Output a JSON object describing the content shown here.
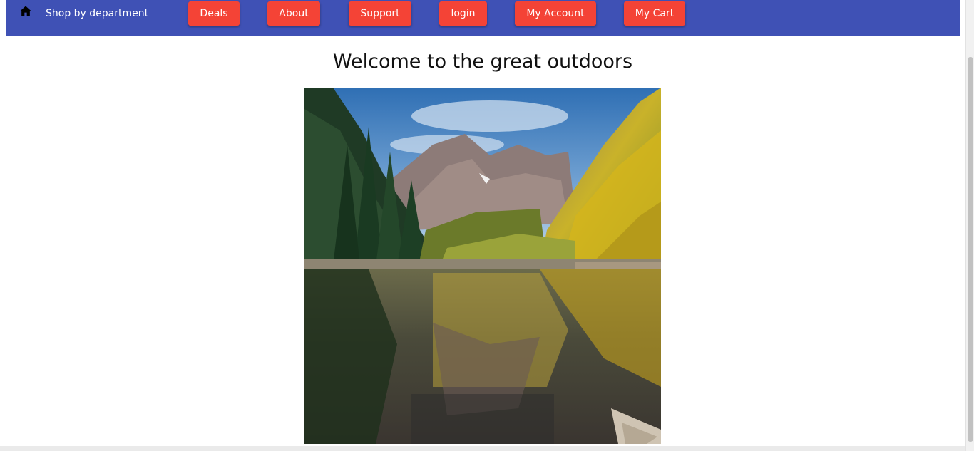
{
  "navbar": {
    "home_icon": "home-icon",
    "department_label": "Shop by department",
    "buttons": [
      {
        "label": "Deals"
      },
      {
        "label": "About"
      },
      {
        "label": "Support"
      },
      {
        "label": "login"
      },
      {
        "label": "My Account"
      },
      {
        "label": "My Cart"
      }
    ],
    "background_color": "#3f51b5",
    "button_color": "#f44336"
  },
  "main": {
    "heading": "Welcome to the great outdoors"
  }
}
